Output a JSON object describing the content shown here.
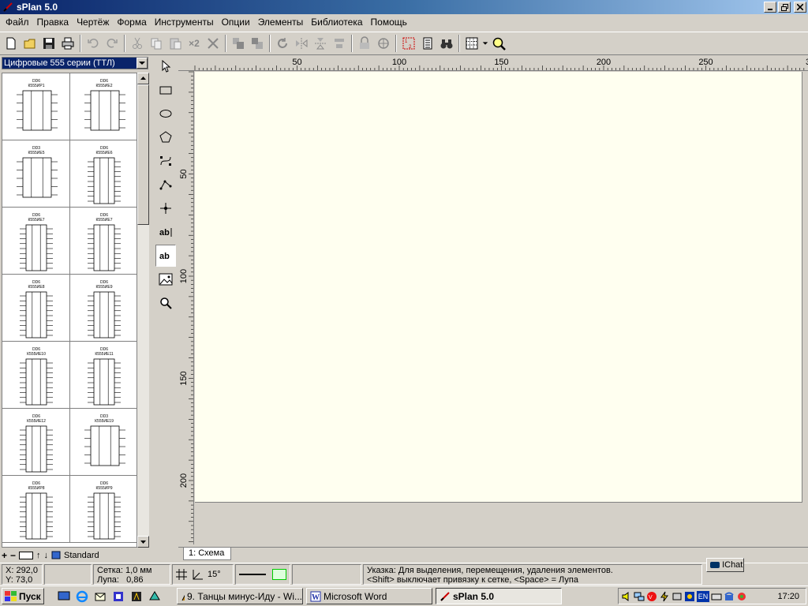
{
  "window": {
    "title": "sPlan 5.0"
  },
  "menu": [
    "Файл",
    "Правка",
    "Чертёж",
    "Форма",
    "Инструменты",
    "Опции",
    "Элементы",
    "Библиотека",
    "Помощь"
  ],
  "toolbar": {
    "copies_label": "×2"
  },
  "library": {
    "category": "Цифровые 555 серии (ТТЛ)",
    "tabs_label": "Standard",
    "components": [
      {
        "name": "DD6",
        "part": "К555ИР1"
      },
      {
        "name": "DD6",
        "part": "К555ИЕ2"
      },
      {
        "name": "DD3",
        "part": "К555ИЕ5"
      },
      {
        "name": "DD6",
        "part": "К555ИЕ6"
      },
      {
        "name": "DD6",
        "part": "К555ИЕ7"
      },
      {
        "name": "DD6",
        "part": "К555ИЕ7"
      },
      {
        "name": "DD6",
        "part": "К555ИЕ8"
      },
      {
        "name": "DD6",
        "part": "К555ИЕ9"
      },
      {
        "name": "DD6",
        "part": "К555ИЕ10"
      },
      {
        "name": "DD6",
        "part": "К555ИЕ11"
      },
      {
        "name": "DD6",
        "part": "К555ИЕ12"
      },
      {
        "name": "DD3",
        "part": "К555ИЕ19"
      },
      {
        "name": "DD6",
        "part": "К555ИР8"
      },
      {
        "name": "DD6",
        "part": "К555ИР9"
      }
    ]
  },
  "ruler": {
    "h_ticks": [
      "50",
      "100",
      "150",
      "200",
      "250",
      "3"
    ],
    "v_ticks": [
      "50",
      "100",
      "150",
      "200"
    ]
  },
  "document": {
    "tab": "1: Схема"
  },
  "status": {
    "x": "X: 292,0",
    "y": "Y: 73,0",
    "grid": "Сетка: 1,0 мм",
    "zoom": "Лупа:   0,86",
    "angle": "15°",
    "hint_line1": "Указка: Для выделения, перемещения, удаления элементов.",
    "hint_line2": "<Shift> выключает привязку к сетке, <Space> = Лупа",
    "ichat": "IChat"
  },
  "taskbar": {
    "start": "Пуск",
    "tasks": [
      "9. Танцы минус-Иду - Wi...",
      "Microsoft Word",
      "sPlan 5.0"
    ],
    "lang": "EN",
    "clock": "17:20"
  }
}
